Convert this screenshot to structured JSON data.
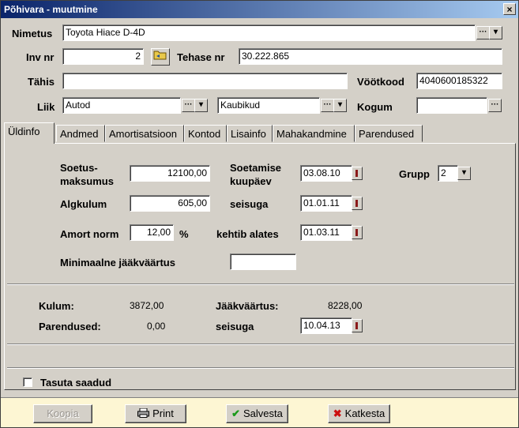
{
  "window": {
    "title": "Põhivara - muutmine",
    "close": "×"
  },
  "header": {
    "nimetus_label": "Nimetus",
    "nimetus_value": "Toyota Hiace D-4D",
    "invnr_label": "Inv nr",
    "invnr_value": "2",
    "tehase_label": "Tehase nr",
    "tehase_value": "30.222.865",
    "tahis_label": "Tähis",
    "tahis_value": "",
    "vootkood_label": "Vöötkood",
    "vootkood_value": "4040600185322",
    "liik_label": "Liik",
    "liik_value": "Autod",
    "liik2_value": "Kaubikud",
    "kogum_label": "Kogum",
    "kogum_value": ""
  },
  "tabs": [
    "Üldinfo",
    "Andmed",
    "Amortisatsioon",
    "Kontod",
    "Lisainfo",
    "Mahakandmine",
    "Parendused"
  ],
  "general": {
    "soetus_label_1": "Soetus-",
    "soetus_label_2": "maksumus",
    "soetus_value": "12100,00",
    "soetamise_label_1": "Soetamise",
    "soetamise_label_2": "kuupäev",
    "soetamise_value": "03.08.10",
    "grupp_label": "Grupp",
    "grupp_value": "2",
    "algkulum_label": "Algkulum",
    "algkulum_value": "605,00",
    "seisuga_label": "seisuga",
    "seisuga_value": "01.01.11",
    "amort_label": "Amort norm",
    "amort_value": "12,00",
    "amort_unit": "%",
    "kehtib_label": "kehtib alates",
    "kehtib_value": "01.03.11",
    "minjaak_label": "Minimaalne jääkväärtus",
    "minjaak_value": ""
  },
  "summary": {
    "kulum_label": "Kulum:",
    "kulum_value": "3872,00",
    "jaak_label": "Jääkväärtus:",
    "jaak_value": "8228,00",
    "parendused_label": "Parendused:",
    "parendused_value": "0,00",
    "seisuga_label": "seisuga",
    "seisuga_value": "10.04.13"
  },
  "tasuta_label": "Tasuta saadud",
  "buttons": {
    "kopia": "Koopia",
    "print": "Print",
    "salvesta": "Salvesta",
    "katkesta": "Katkesta"
  }
}
